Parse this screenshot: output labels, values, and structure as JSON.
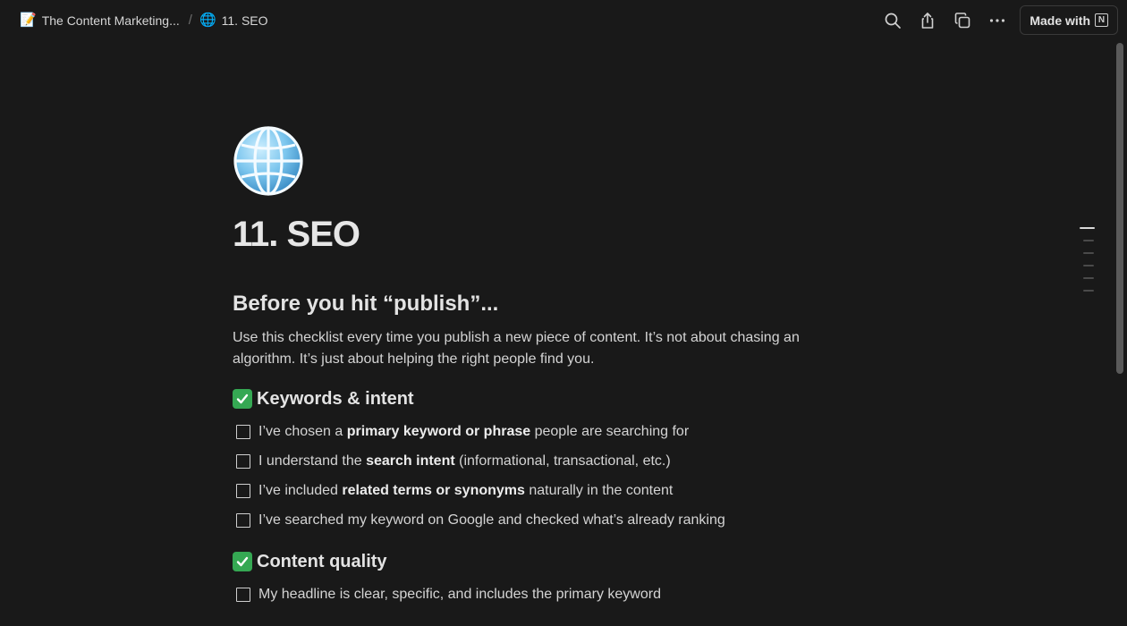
{
  "breadcrumb": {
    "parent": {
      "icon": "📝",
      "label": "The Content Marketing..."
    },
    "separator": "/",
    "current": {
      "icon": "🌐",
      "label": "11. SEO"
    }
  },
  "toolbar": {
    "search_icon": "search-icon",
    "share_icon": "share-icon",
    "duplicate_icon": "duplicate-icon",
    "more_icon": "more-icon",
    "made_with_label": "Made with",
    "notion_logo_letter": "N"
  },
  "page": {
    "icon": "globe-icon",
    "title": "11. SEO",
    "heading": "Before you hit “publish”...",
    "intro": "Use this checklist every time you publish a new piece of content. It’s not about chasing an algorithm. It’s just about helping the right people find you."
  },
  "sections": [
    {
      "title": "Keywords & intent",
      "items": [
        {
          "before": "I’ve chosen a ",
          "bold": "primary keyword or phrase",
          "after": " people are searching for",
          "checked": false
        },
        {
          "before": "I understand the ",
          "bold": "search intent",
          "after": " (informational, transactional, etc.)",
          "checked": false
        },
        {
          "before": "I’ve included ",
          "bold": "related terms or synonyms",
          "after": " naturally in the content",
          "checked": false
        },
        {
          "before": "I’ve searched my keyword on Google and checked what’s already ranking",
          "bold": "",
          "after": "",
          "checked": false
        }
      ]
    },
    {
      "title": "Content quality",
      "items": [
        {
          "before": "My headline is clear, specific, and includes the primary keyword",
          "bold": "",
          "after": "",
          "checked": false
        }
      ]
    }
  ],
  "colors": {
    "background": "#191919",
    "text": "#d4d4d4",
    "heading": "#e3e3e3",
    "check_green": "#35a853"
  }
}
